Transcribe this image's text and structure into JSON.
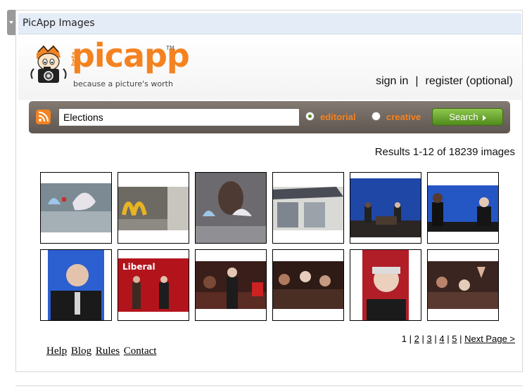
{
  "widget": {
    "title": "PicApp Images"
  },
  "logo": {
    "beta": "beta",
    "word": "picapp",
    "tm": "TM",
    "tagline": "because a picture's worth"
  },
  "auth": {
    "sign_in": "sign in",
    "separator": "|",
    "register": "register (optional)"
  },
  "search": {
    "query": "Elections",
    "options": [
      {
        "label": "editorial",
        "selected": true
      },
      {
        "label": "creative",
        "selected": false
      }
    ],
    "button_label": "Search",
    "colors": {
      "accent": "#f58220",
      "button": "#6aa834"
    }
  },
  "results": {
    "text": "Results 1-12 of 18239 images"
  },
  "thumbnails": [
    {
      "name": "bra-storefront"
    },
    {
      "name": "mcdonalds-window"
    },
    {
      "name": "obama-window-poster"
    },
    {
      "name": "storefront-awning"
    },
    {
      "name": "debate-stage-wide"
    },
    {
      "name": "debate-obama-mccain"
    },
    {
      "name": "mccain-portrait"
    },
    {
      "name": "liberal-rally"
    },
    {
      "name": "candidate-crowd"
    },
    {
      "name": "press-crowd"
    },
    {
      "name": "dion-portrait"
    },
    {
      "name": "rally-hands"
    }
  ],
  "pagination": {
    "current": "1",
    "sep": "|",
    "pages": [
      "2",
      "3",
      "4",
      "5"
    ],
    "next": "Next Page >"
  },
  "footer": {
    "links": [
      "Help",
      "Blog",
      "Rules",
      "Contact"
    ]
  }
}
